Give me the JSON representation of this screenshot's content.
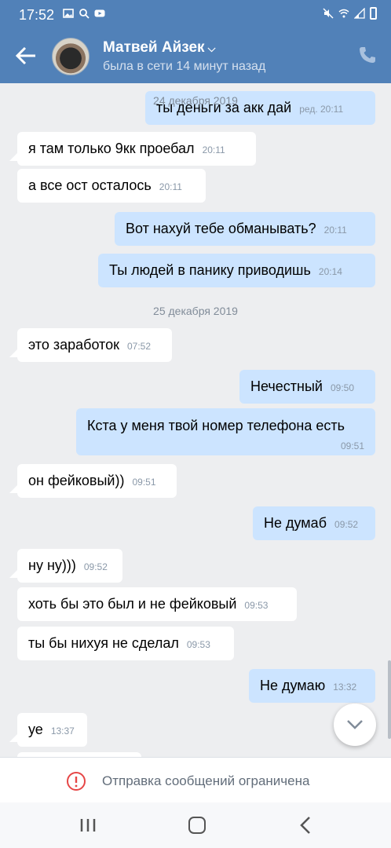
{
  "status_bar": {
    "time": "17:52",
    "left_icons": [
      "image-icon",
      "search-icon",
      "youtube-icon"
    ],
    "right_icons": [
      "mute-icon",
      "wifi-icon",
      "signal-icon",
      "battery-icon"
    ]
  },
  "header": {
    "contact_name": "Матвей Айзек",
    "last_seen": "была в сети 14 минут назад",
    "icons": [
      "back-arrow-icon",
      "chevron-down-icon",
      "phone-icon"
    ]
  },
  "messages": [
    {
      "dir": "out",
      "text": "ты деньги за акк дай",
      "time": "ред. 20:11"
    },
    {
      "dir": "in",
      "text": "я там только 9кк проебал",
      "time": "20:11"
    },
    {
      "dir": "in",
      "text": "а все ост осталось",
      "time": "20:11"
    },
    {
      "dir": "out",
      "text": "Вот нахуй тебе обманывать?",
      "time": "20:11"
    },
    {
      "dir": "out",
      "text": "Ты людей в панику приводишь",
      "time": "20:14"
    },
    {
      "dir": "in",
      "text": "это заработок",
      "time": "07:52"
    },
    {
      "dir": "out",
      "text": "Нечестный",
      "time": "09:50"
    },
    {
      "dir": "out",
      "text": "Кста у меня твой номер телефона есть",
      "time": "09:51"
    },
    {
      "dir": "in",
      "text": "он фейковый))",
      "time": "09:51"
    },
    {
      "dir": "out",
      "text": "Не думаб",
      "time": "09:52"
    },
    {
      "dir": "in",
      "text": "ну ну)))",
      "time": "09:52"
    },
    {
      "dir": "in",
      "text": "хоть бы это был и не фейковый",
      "time": "09:53"
    },
    {
      "dir": "in",
      "text": "ты бы нихуя не сделал",
      "time": "09:53"
    },
    {
      "dir": "out",
      "text": "Не думаю",
      "time": "13:32"
    },
    {
      "dir": "in",
      "text": "уе",
      "time": "13:37"
    }
  ],
  "dates": [
    "24 декабря 2019",
    "25 декабря 2019"
  ],
  "composer": {
    "restricted_text": "Отправка сообщений ограничена",
    "icon": "warning-circle-icon"
  },
  "scroll_down_icon": "chevron-down-icon",
  "nav_icons": [
    "recent-apps-icon",
    "home-icon",
    "nav-back-icon"
  ],
  "colors": {
    "header_bg": "#5181b8",
    "chat_bg": "#edeef0",
    "outgoing_bubble": "#cce4ff",
    "incoming_bubble": "#ffffff",
    "warning_red": "#e64646"
  }
}
